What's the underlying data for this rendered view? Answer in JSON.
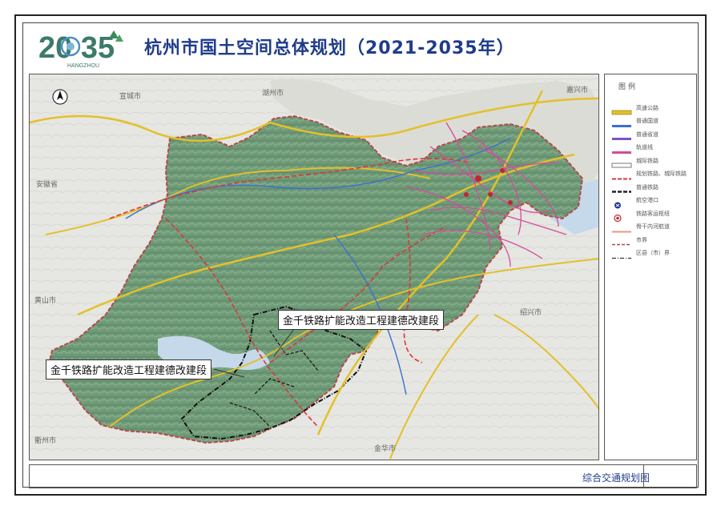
{
  "header": {
    "title": "杭州市国土空间总体规划（2021-2035年）",
    "logo": {
      "number": "20 35",
      "subtext": "HANGZHOU"
    }
  },
  "map": {
    "callouts": [
      "金千铁路扩能改造工程建德改建段",
      "金千铁路扩能改造工程建德改建段"
    ],
    "place_labels": [
      "嘉兴市",
      "湖州市",
      "宣城市",
      "绍兴市",
      "金华市",
      "衢州市",
      "黄山市",
      "安徽省"
    ],
    "colors": {
      "region_fill": "#6f9a78",
      "region_border": "#b24a4a",
      "outside": "#e6e6e2",
      "water": "#c5d9ea",
      "expressway": "#e3c02a",
      "railway": "#d44b9b",
      "planned_rail": "#d9383a",
      "national_road": "#3a6fd1"
    }
  },
  "legend": {
    "title": "图例",
    "items": [
      {
        "label": "高速公路",
        "style": "expressway"
      },
      {
        "label": "普通国道",
        "style": "national"
      },
      {
        "label": "普通省道",
        "style": "provincial"
      },
      {
        "label": "轨道线",
        "style": "rail-transit"
      },
      {
        "label": "城际铁路",
        "style": "intercity"
      },
      {
        "label": "规划铁路、城际铁路",
        "style": "planned-rail"
      },
      {
        "label": "普通铁路",
        "style": "railway"
      },
      {
        "label": "航空港口",
        "style": "airport"
      },
      {
        "label": "铁路客运枢纽",
        "style": "hub"
      },
      {
        "label": "骨干内河航道",
        "style": "waterway"
      },
      {
        "label": "市界",
        "style": "city-border"
      },
      {
        "label": "区县（市）界",
        "style": "county-border"
      }
    ]
  },
  "footer": {
    "label": "综合交通规划图"
  }
}
